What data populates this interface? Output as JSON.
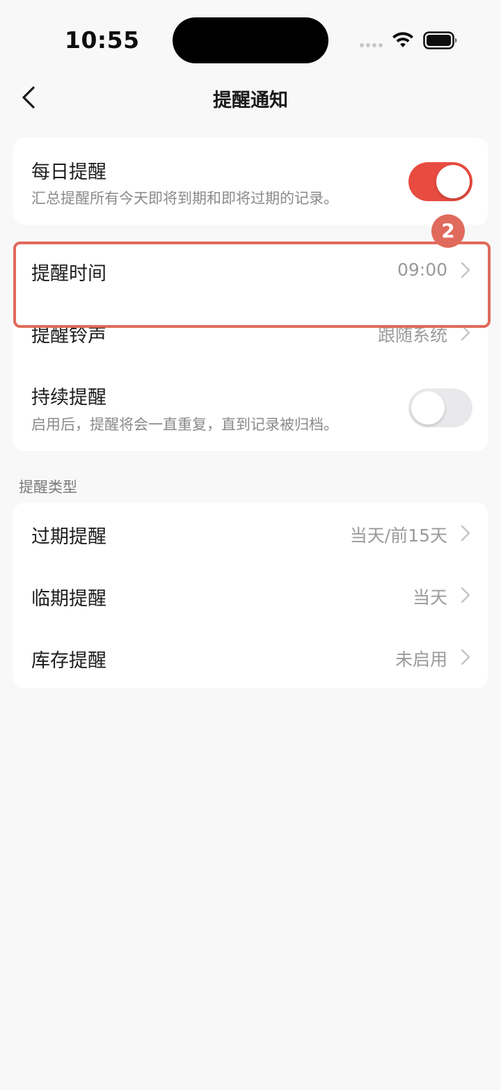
{
  "status_bar": {
    "time": "10:55"
  },
  "nav": {
    "title": "提醒通知",
    "back_icon": "chevron-left-icon"
  },
  "daily": {
    "title": "每日提醒",
    "subtitle": "汇总提醒所有今天即将到期和即将过期的记录。",
    "enabled": true
  },
  "settings": {
    "time": {
      "label": "提醒时间",
      "value": "09:00"
    },
    "sound": {
      "label": "提醒铃声",
      "value": "跟随系统"
    },
    "repeat": {
      "label": "持续提醒",
      "subtitle": "启用后，提醒将会一直重复，直到记录被归档。",
      "enabled": false
    }
  },
  "types": {
    "header": "提醒类型",
    "items": [
      {
        "label": "过期提醒",
        "value": "当天/前15天"
      },
      {
        "label": "临期提醒",
        "value": "当天"
      },
      {
        "label": "库存提醒",
        "value": "未启用"
      }
    ]
  },
  "annotation": {
    "step": "2",
    "color": "#e06a5c"
  },
  "colors": {
    "accent": "#e84b40",
    "background": "#f8f8f8",
    "card": "#ffffff"
  }
}
